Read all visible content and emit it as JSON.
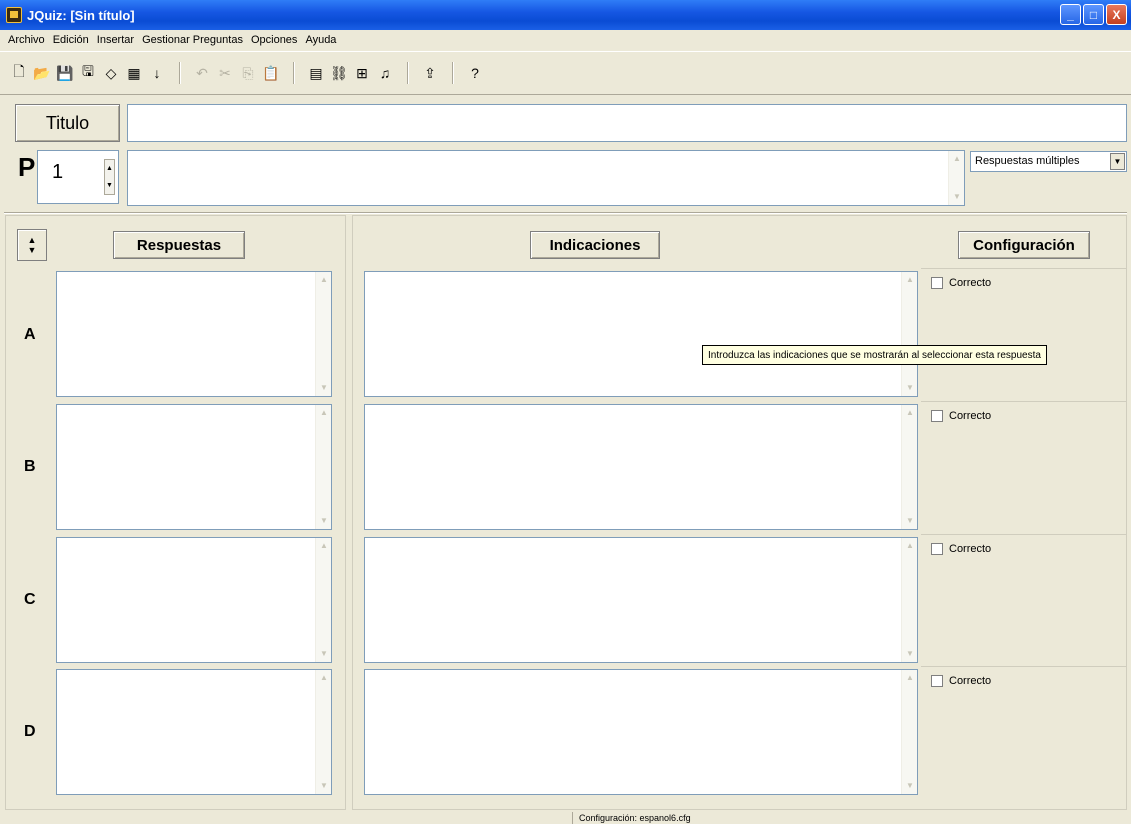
{
  "window": {
    "title": "JQuiz: [Sin título]",
    "buttons": {
      "minimize": "_",
      "maximize": "□",
      "close": "X"
    }
  },
  "menu": [
    "Archivo",
    "Edición",
    "Insertar",
    "Gestionar Preguntas",
    "Opciones",
    "Ayuda"
  ],
  "toolbar": {
    "groups": [
      [
        {
          "icon": "new-file-icon",
          "glyph": "🗋"
        },
        {
          "icon": "open-folder-icon",
          "glyph": "📂"
        },
        {
          "icon": "save-icon",
          "glyph": "💾"
        },
        {
          "icon": "save-as-icon",
          "glyph": "🖫"
        },
        {
          "icon": "eraser-icon",
          "glyph": "◇"
        },
        {
          "icon": "web-page-icon",
          "glyph": "▦"
        },
        {
          "icon": "down-arrow-icon",
          "glyph": "↓"
        }
      ],
      [
        {
          "icon": "undo-icon",
          "glyph": "↶",
          "disabled": true
        },
        {
          "icon": "cut-icon",
          "glyph": "✂",
          "disabled": true
        },
        {
          "icon": "copy-icon",
          "glyph": "⎘",
          "disabled": true
        },
        {
          "icon": "paste-icon",
          "glyph": "📋",
          "disabled": true
        }
      ],
      [
        {
          "icon": "insert-picture-icon",
          "glyph": "▤"
        },
        {
          "icon": "insert-link-icon",
          "glyph": "⛓"
        },
        {
          "icon": "insert-table-icon",
          "glyph": "⊞"
        },
        {
          "icon": "insert-media-icon",
          "glyph": "♫"
        }
      ],
      [
        {
          "icon": "export-icon",
          "glyph": "⇪"
        }
      ],
      [
        {
          "icon": "help-icon",
          "glyph": "?"
        }
      ]
    ]
  },
  "title_row": {
    "label": "Titulo",
    "value": ""
  },
  "question": {
    "label": "P",
    "number": "1",
    "text": "",
    "type": "Respuestas múltiples"
  },
  "headers": {
    "answers": "Respuestas",
    "feedback": "Indicaciones",
    "settings": "Configuración"
  },
  "rows": [
    {
      "letter": "A",
      "answer": "",
      "feedback": "",
      "correct_label": "Correcto"
    },
    {
      "letter": "B",
      "answer": "",
      "feedback": "",
      "correct_label": "Correcto"
    },
    {
      "letter": "C",
      "answer": "",
      "feedback": "",
      "correct_label": "Correcto"
    },
    {
      "letter": "D",
      "answer": "",
      "feedback": "",
      "correct_label": "Correcto"
    }
  ],
  "tooltip": "Introduzca las indicaciones que se mostrarán al seleccionar esta respuesta",
  "status": "Configuración: espanol6.cfg",
  "colors": {
    "titlebar": "#0a4cd4",
    "window_bg": "#ece9d8",
    "field_border": "#7f9db9",
    "tooltip_bg": "#ffffe1"
  }
}
